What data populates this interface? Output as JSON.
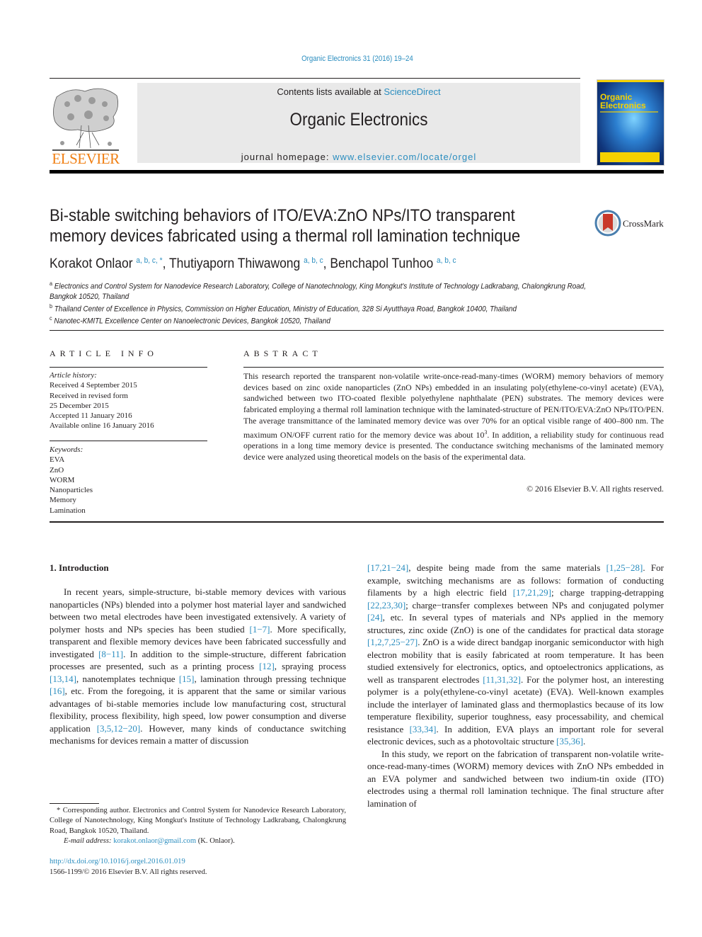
{
  "header": {
    "journal_citation": "Organic Electronics 31 (2016) 19–24",
    "contents_prefix": "Contents lists available at ",
    "contents_link": "ScienceDirect",
    "journal_name": "Organic Electronics",
    "homepage_prefix": "journal homepage: ",
    "homepage_link": "www.elsevier.com/locate/orgel",
    "publisher_wordmark": "ELSEVIER",
    "cover": {
      "title_line1": "Organic",
      "title_line2": "Electronics",
      "accent_color": "#f5d100"
    },
    "crossmark_label": "CrossMark"
  },
  "article": {
    "title": "Bi-stable switching behaviors of ITO/EVA:ZnO NPs/ITO transparent memory devices fabricated using a thermal roll lamination technique",
    "authors": [
      {
        "name": "Korakot Onlaor",
        "affil": "a, b, c, *"
      },
      {
        "name": "Thutiyaporn Thiwawong",
        "affil": "a, b, c"
      },
      {
        "name": "Benchapol Tunhoo",
        "affil": "a, b, c"
      }
    ],
    "author_separator": ", ",
    "affiliations": [
      {
        "mark": "a",
        "text": "Electronics and Control System for Nanodevice Research Laboratory, College of Nanotechnology, King Mongkut's Institute of Technology Ladkrabang, Chalongkrung Road, Bangkok 10520, Thailand"
      },
      {
        "mark": "b",
        "text": "Thailand Center of Excellence in Physics, Commission on Higher Education, Ministry of Education, 328 Si Ayutthaya Road, Bangkok 10400, Thailand"
      },
      {
        "mark": "c",
        "text": "Nanotec-KMITL Excellence Center on Nanoelectronic Devices, Bangkok 10520, Thailand"
      }
    ]
  },
  "article_info": {
    "heading": "ARTICLE INFO",
    "history_label": "Article history:",
    "history": [
      "Received 4 September 2015",
      "Received in revised form",
      "25 December 2015",
      "Accepted 11 January 2016",
      "Available online 16 January 2016"
    ],
    "keywords_label": "Keywords:",
    "keywords": [
      "EVA",
      "ZnO",
      "WORM",
      "Nanoparticles",
      "Memory",
      "Lamination"
    ]
  },
  "abstract": {
    "heading": "ABSTRACT",
    "text_part1": "This research reported the transparent non-volatile write-once-read-many-times (WORM) memory behaviors of memory devices based on zinc oxide nanoparticles (ZnO NPs) embedded in an insulating poly(ethylene-co-vinyl acetate) (EVA), sandwiched between two ITO-coated flexible polyethylene naphthalate (PEN) substrates. The memory devices were fabricated employing a thermal roll lamination technique with the laminated-structure of PEN/ITO/EVA:ZnO NPs/ITO/PEN. The average transmittance of the laminated memory device was over 70% for an optical visible range of 400–800 nm. The maximum ON/OFF current ratio for the memory device was about 10",
    "text_sup": "3",
    "text_part2": ". In addition, a reliability study for continuous read operations in a long time memory device is presented. The conductance switching mechanisms of the laminated memory device were analyzed using theoretical models on the basis of the experimental data.",
    "copyright": "© 2016 Elsevier B.V. All rights reserved."
  },
  "body": {
    "section_heading": "1.  Introduction",
    "left_col": [
      {
        "t": "In recent years, simple-structure, bi-stable memory devices with various nanoparticles (NPs) blended into a polymer host material layer and sandwiched between two metal electrodes have been investigated extensively. A variety of polymer hosts and NPs species has been studied "
      },
      {
        "ref": "[1−7]"
      },
      {
        "t": ". More specifically, transparent and flexible memory devices have been fabricated successfully and investigated "
      },
      {
        "ref": "[8−11]"
      },
      {
        "t": ". In addition to the simple-structure, different fabrication processes are presented, such as a printing process "
      },
      {
        "ref": "[12]"
      },
      {
        "t": ", spraying process "
      },
      {
        "ref": "[13,14]"
      },
      {
        "t": ", nanotemplates technique "
      },
      {
        "ref": "[15]"
      },
      {
        "t": ", lamination through pressing technique "
      },
      {
        "ref": "[16]"
      },
      {
        "t": ", etc. From the foregoing, it is apparent that the same or similar various advantages of bi-stable memories include low manufacturing cost, structural flexibility, process flexibility, high speed, low power consumption and diverse application "
      },
      {
        "ref": "[3,5,12−20]"
      },
      {
        "t": ". However, many kinds of conductance switching mechanisms for devices remain a matter of discussion"
      }
    ],
    "right_col_p1": [
      {
        "ref": "[17,21−24]"
      },
      {
        "t": ", despite being made from the same materials "
      },
      {
        "ref": "[1,25−28]"
      },
      {
        "t": ". For example, switching mechanisms are as follows: formation of conducting filaments by a high electric field "
      },
      {
        "ref": "[17,21,29]"
      },
      {
        "t": "; charge trapping-detrapping "
      },
      {
        "ref": "[22,23,30]"
      },
      {
        "t": "; charge−transfer complexes be­tween NPs and conjugated polymer "
      },
      {
        "ref": "[24]"
      },
      {
        "t": ", etc. In several types of materials and NPs applied in the memory structures, zinc oxide (ZnO) is one of the candidates for practical data storage "
      },
      {
        "ref": "[1,2,7,25−27]"
      },
      {
        "t": ". ZnO is a wide direct bandgap inorganic semi­conductor with high electron mobility that is easily fabricated at room temperature. It has been studied extensively for electronics, optics, and optoelectronics applications, as well as transparent electrodes "
      },
      {
        "ref": "[11,31,32]"
      },
      {
        "t": ". For the polymer host, an interesting polymer is a poly(ethylene-co-vinyl acetate) (EVA). Well-known examples include the interlayer of laminated glass and thermoplastics because of its low temperature flexibility, superior toughness, easy processability, and chemical resistance "
      },
      {
        "ref": "[33,34]"
      },
      {
        "t": ". In addition, EVA plays an important role for several electronic devices, such as a photovoltaic structure "
      },
      {
        "ref": "[35,36]"
      },
      {
        "t": "."
      }
    ],
    "right_col_p2": "In this study, we report on the fabrication of transparent non-volatile write-once-read-many-times (WORM) memory devices with ZnO NPs embedded in an EVA polymer and sandwiched be­tween two indium-tin oxide (ITO) electrodes using a thermal roll lamination technique. The final structure after lamination of"
  },
  "footnotes": {
    "corresponding": "* Corresponding author. Electronics and Control System for Nanodevice Research Laboratory, College of Nanotechnology, King Mongkut's Institute of Technology Ladkrabang, Chalongkrung Road, Bangkok 10520, Thailand.",
    "email_label": "E-mail address: ",
    "email": "korakot.onlaor@gmail.com",
    "email_suffix": " (K. Onlaor).",
    "doi": "http://dx.doi.org/10.1016/j.orgel.2016.01.019",
    "issn": "1566-1199/© 2016 Elsevier B.V. All rights reserved."
  },
  "colors": {
    "link": "#2a8dbf",
    "elsevier_orange": "#f07f13",
    "header_box": "#e9e9e9",
    "text": "#231f20"
  }
}
